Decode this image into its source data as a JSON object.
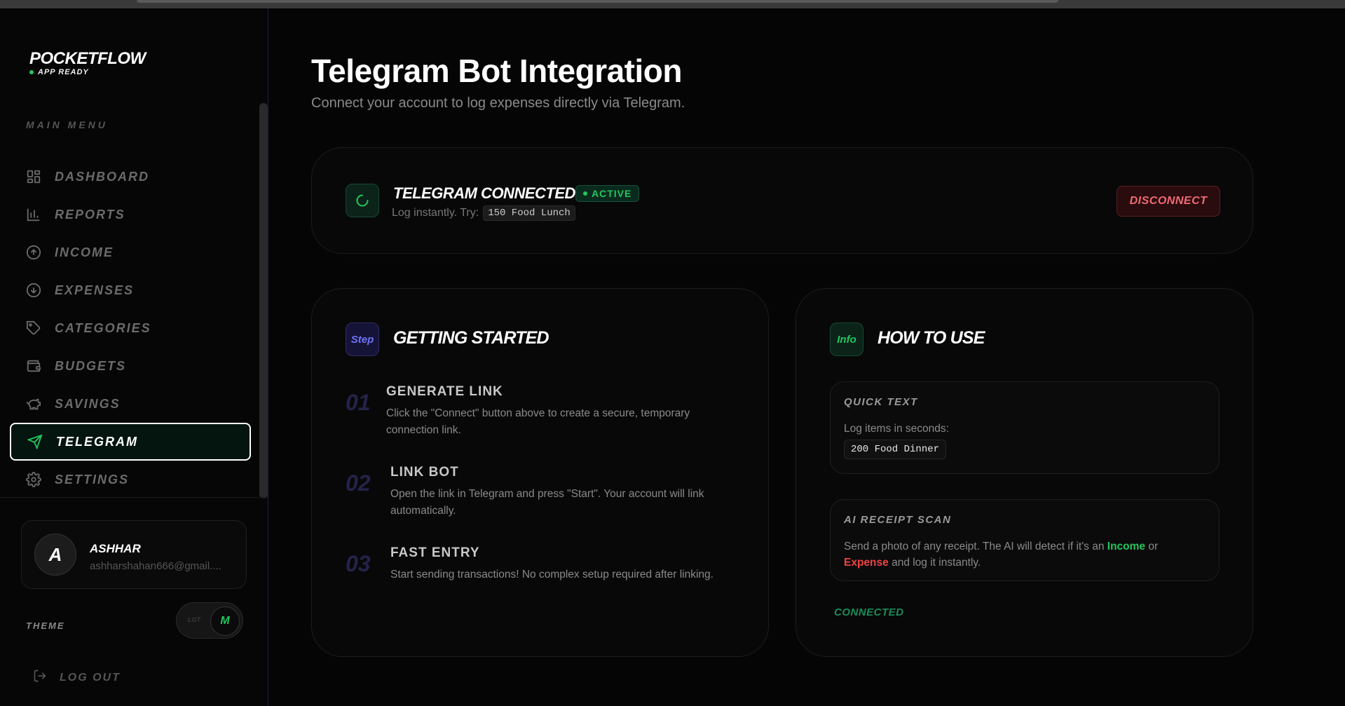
{
  "app": {
    "logo_title": "POCKETFLOW",
    "logo_sub": "APP READY",
    "accent": "#22c55e"
  },
  "sidebar": {
    "menu_heading": "MAIN MENU",
    "items": [
      {
        "label": "DASHBOARD",
        "icon": "grid-icon"
      },
      {
        "label": "REPORTS",
        "icon": "bar-chart-icon"
      },
      {
        "label": "INCOME",
        "icon": "arrow-up-circle-icon"
      },
      {
        "label": "EXPENSES",
        "icon": "arrow-down-circle-icon"
      },
      {
        "label": "CATEGORIES",
        "icon": "tag-icon"
      },
      {
        "label": "BUDGETS",
        "icon": "wallet-icon"
      },
      {
        "label": "SAVINGS",
        "icon": "piggy-bank-icon"
      },
      {
        "label": "TELEGRAM",
        "icon": "send-icon",
        "active": true
      },
      {
        "label": "SETTINGS",
        "icon": "gear-icon"
      }
    ],
    "profile": {
      "initial": "A",
      "name": "ASHHAR",
      "email": "ashharshahan666@gmail...."
    },
    "theme": {
      "label": "THEME",
      "off_text": "LGT",
      "on_text": "M"
    },
    "logout_label": "LOG OUT"
  },
  "main": {
    "title": "Telegram Bot Integration",
    "subtitle": "Connect your account to log expenses directly via Telegram.",
    "status": {
      "title": "TELEGRAM CONNECTED",
      "badge": "ACTIVE",
      "hint": "Log instantly. Try:",
      "hint_code": "150 Food Lunch",
      "disconnect_label": "DISCONNECT"
    },
    "getting_started": {
      "chip": "Step",
      "title": "GETTING STARTED",
      "steps": [
        {
          "num": "01",
          "title": "GENERATE LINK",
          "desc": "Click the \"Connect\" button above to create a secure, temporary connection link."
        },
        {
          "num": "02",
          "title": "LINK BOT",
          "desc": "Open the link in Telegram and press \"Start\". Your account will link automatically."
        },
        {
          "num": "03",
          "title": "FAST ENTRY",
          "desc": "Start sending transactions! No complex setup required after linking."
        }
      ]
    },
    "how_to_use": {
      "chip": "Info",
      "title": "HOW TO USE",
      "quick_text": {
        "title": "QUICK TEXT",
        "text": "Log items in seconds:",
        "code": "200 Food Dinner"
      },
      "ai_scan": {
        "title": "AI RECEIPT SCAN",
        "text_1": "Send a photo of any receipt. The AI will detect if it's an ",
        "income": "Income",
        "text_2": " or",
        "expense": "Expense",
        "text_3": " and log it instantly."
      },
      "footer": "CONNECTED"
    }
  }
}
